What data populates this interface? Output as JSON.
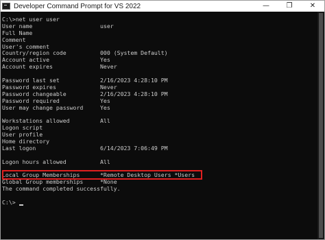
{
  "window": {
    "title": "Developer Command Prompt for VS 2022",
    "icon": "console-icon",
    "controls": {
      "minimize": "—",
      "maximize": "❐",
      "close": "✕"
    }
  },
  "terminal": {
    "lines": [
      {
        "k": "C:\\>net user user",
        "v": ""
      },
      {
        "k": "User name",
        "v": "user"
      },
      {
        "k": "Full Name",
        "v": ""
      },
      {
        "k": "Comment",
        "v": ""
      },
      {
        "k": "User's comment",
        "v": ""
      },
      {
        "k": "Country/region code",
        "v": "000 (System Default)"
      },
      {
        "k": "Account active",
        "v": "Yes"
      },
      {
        "k": "Account expires",
        "v": "Never"
      },
      {
        "k": "",
        "v": ""
      },
      {
        "k": "Password last set",
        "v": "2/16/2023 4:28:10 PM"
      },
      {
        "k": "Password expires",
        "v": "Never"
      },
      {
        "k": "Password changeable",
        "v": "2/16/2023 4:28:10 PM"
      },
      {
        "k": "Password required",
        "v": "Yes"
      },
      {
        "k": "User may change password",
        "v": "Yes"
      },
      {
        "k": "",
        "v": ""
      },
      {
        "k": "Workstations allowed",
        "v": "All"
      },
      {
        "k": "Logon script",
        "v": ""
      },
      {
        "k": "User profile",
        "v": ""
      },
      {
        "k": "Home directory",
        "v": ""
      },
      {
        "k": "Last logon",
        "v": "6/14/2023 7:06:49 PM"
      },
      {
        "k": "",
        "v": ""
      },
      {
        "k": "Logon hours allowed",
        "v": "All"
      },
      {
        "k": "",
        "v": ""
      },
      {
        "k": "Local Group Memberships",
        "v": "*Remote Desktop Users *Users"
      },
      {
        "k": "Global Group memberships",
        "v": "*None"
      },
      {
        "k": "The command completed successfully.",
        "v": ""
      },
      {
        "k": "",
        "v": ""
      },
      {
        "k": "C:\\>",
        "v": ""
      }
    ]
  },
  "colors": {
    "console_bg": "#0c0c0c",
    "console_text": "#cccccc",
    "highlight": "#e02020"
  }
}
